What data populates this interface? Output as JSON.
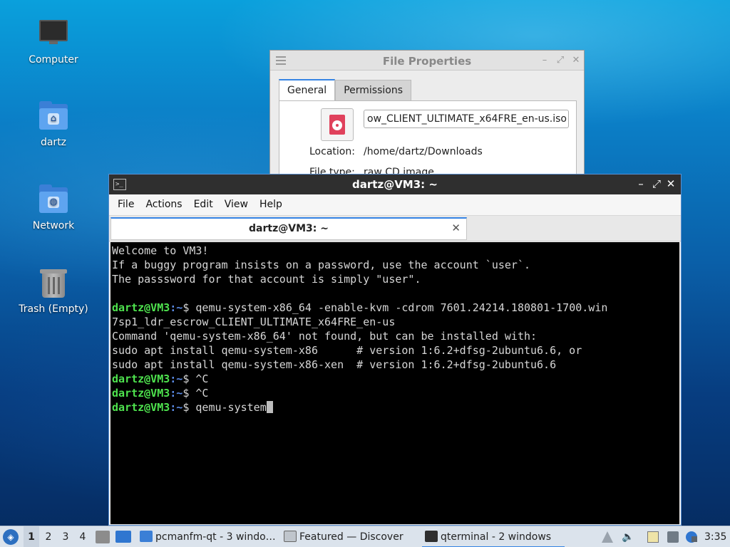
{
  "desktop": {
    "icons": [
      {
        "label": "Computer"
      },
      {
        "label": "dartz"
      },
      {
        "label": "Network"
      },
      {
        "label": "Trash (Empty)"
      }
    ]
  },
  "file_properties": {
    "title": "File Properties",
    "tabs": [
      "General",
      "Permissions"
    ],
    "filename": "ow_CLIENT_ULTIMATE_x64FRE_en-us.iso",
    "location_label": "Location:",
    "location_value": "/home/dartz/Downloads",
    "filetype_label": "File type:",
    "filetype_value": "raw CD image"
  },
  "terminal": {
    "title": "dartz@VM3: ~",
    "menu": [
      "File",
      "Actions",
      "Edit",
      "View",
      "Help"
    ],
    "tab_label": "dartz@VM3: ~",
    "lines": [
      {
        "text": "Welcome to VM3!"
      },
      {
        "text": "If a buggy program insists on a password, use the account `user`."
      },
      {
        "text": "The passsword for that account is simply \"user\"."
      },
      {
        "text": ""
      },
      {
        "user": "dartz@VM3",
        "path": ":~",
        "text": "$ qemu-system-x86_64 -enable-kvm -cdrom 7601.24214.180801-1700.win"
      },
      {
        "text": "7sp1_ldr_escrow_CLIENT_ULTIMATE_x64FRE_en-us"
      },
      {
        "text": "Command 'qemu-system-x86_64' not found, but can be installed with:"
      },
      {
        "text": "sudo apt install qemu-system-x86      # version 1:6.2+dfsg-2ubuntu6.6, or"
      },
      {
        "text": "sudo apt install qemu-system-x86-xen  # version 1:6.2+dfsg-2ubuntu6.6"
      },
      {
        "user": "dartz@VM3",
        "path": ":~",
        "text": "$ ^C"
      },
      {
        "user": "dartz@VM3",
        "path": ":~",
        "text": "$ ^C"
      },
      {
        "user": "dartz@VM3",
        "path": ":~",
        "text": "$ qemu-system"
      }
    ]
  },
  "taskbar": {
    "workspaces": [
      "1",
      "2",
      "3",
      "4"
    ],
    "tasks": [
      {
        "label": "pcmanfm-qt - 3 windo…"
      },
      {
        "label": "Featured — Discover"
      },
      {
        "label": "qterminal - 2 windows"
      }
    ],
    "clock": "3:35"
  },
  "colors": {
    "prompt_user": "#4ee34e",
    "prompt_path": "#5b8be6",
    "accent": "#3584e4"
  }
}
